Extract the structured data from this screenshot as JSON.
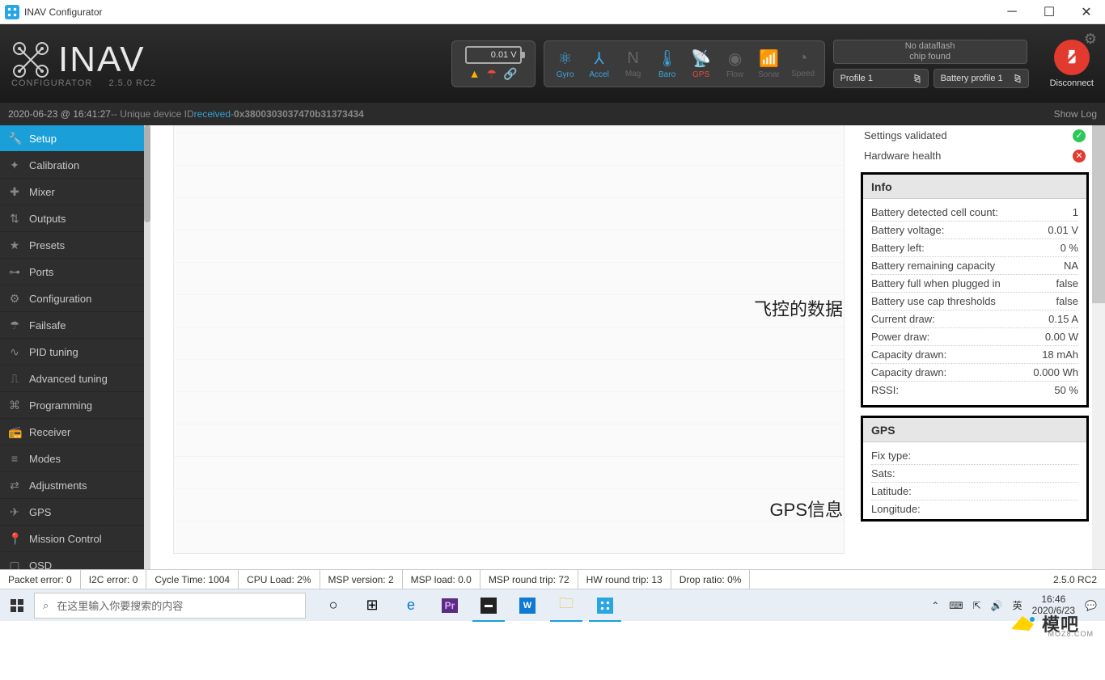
{
  "window": {
    "title": "INAV Configurator"
  },
  "logo": {
    "name": "INAV",
    "sub_left": "CONFIGURATOR",
    "sub_right": "2.5.0 RC2"
  },
  "battery": {
    "voltage": "0.01 V"
  },
  "sensors": [
    {
      "label": "Gyro",
      "cls": "s-blue",
      "glyph": "⚛"
    },
    {
      "label": "Accel",
      "cls": "s-blue",
      "glyph": "⅄"
    },
    {
      "label": "Mag",
      "cls": "s-grey",
      "glyph": "N"
    },
    {
      "label": "Baro",
      "cls": "s-blue",
      "glyph": "🌡"
    },
    {
      "label": "GPS",
      "cls": "s-red",
      "glyph": "📡"
    },
    {
      "label": "Flow",
      "cls": "s-grey",
      "glyph": "◉"
    },
    {
      "label": "Sonar",
      "cls": "s-grey",
      "glyph": "📶"
    },
    {
      "label": "Speed",
      "cls": "s-grey",
      "glyph": "◔"
    }
  ],
  "dataflash": {
    "line1": "No dataflash",
    "line2": "chip found"
  },
  "profiles": {
    "profile": "Profile 1",
    "battery": "Battery profile 1"
  },
  "disconnect": "Disconnect",
  "log": {
    "timestamp": "2020-06-23 @ 16:41:27",
    "mid": " -- Unique device ID ",
    "received": "received",
    "dash": " - ",
    "hex": "0x3800303037470b31373434",
    "showlog": "Show Log"
  },
  "sidebar": [
    {
      "label": "Setup",
      "icon": "🔧",
      "active": true
    },
    {
      "label": "Calibration",
      "icon": "✦"
    },
    {
      "label": "Mixer",
      "icon": "✚"
    },
    {
      "label": "Outputs",
      "icon": "⇅"
    },
    {
      "label": "Presets",
      "icon": "★"
    },
    {
      "label": "Ports",
      "icon": "⊶"
    },
    {
      "label": "Configuration",
      "icon": "⚙"
    },
    {
      "label": "Failsafe",
      "icon": "☂"
    },
    {
      "label": "PID tuning",
      "icon": "∿"
    },
    {
      "label": "Advanced tuning",
      "icon": "⎍"
    },
    {
      "label": "Programming",
      "icon": "⌘"
    },
    {
      "label": "Receiver",
      "icon": "📻"
    },
    {
      "label": "Modes",
      "icon": "≡"
    },
    {
      "label": "Adjustments",
      "icon": "⇄"
    },
    {
      "label": "GPS",
      "icon": "✈"
    },
    {
      "label": "Mission Control",
      "icon": "📍"
    },
    {
      "label": "OSD",
      "icon": "▢"
    }
  ],
  "annotations": {
    "fc_data": "飞控的数据",
    "gps_info": "GPS信息"
  },
  "status_checks": [
    {
      "label": "Settings validated",
      "ok": true
    },
    {
      "label": "Hardware health",
      "ok": false
    }
  ],
  "info_panel": {
    "title": "Info",
    "rows": [
      {
        "k": "Battery detected cell count:",
        "v": "1"
      },
      {
        "k": "Battery voltage:",
        "v": "0.01 V"
      },
      {
        "k": "Battery left:",
        "v": "0 %"
      },
      {
        "k": "Battery remaining capacity",
        "v": "NA"
      },
      {
        "k": "Battery full when plugged in",
        "v": "false"
      },
      {
        "k": "Battery use cap thresholds",
        "v": "false"
      },
      {
        "k": "Current draw:",
        "v": "0.15 A"
      },
      {
        "k": "Power draw:",
        "v": "0.00 W"
      },
      {
        "k": "Capacity drawn:",
        "v": "18 mAh"
      },
      {
        "k": "Capacity drawn:",
        "v": "0.000 Wh"
      },
      {
        "k": "RSSI:",
        "v": "50 %"
      }
    ]
  },
  "gps_panel": {
    "title": "GPS",
    "rows": [
      {
        "k": "Fix type:",
        "v": ""
      },
      {
        "k": "Sats:",
        "v": ""
      },
      {
        "k": "Latitude:",
        "v": ""
      },
      {
        "k": "Longitude:",
        "v": ""
      }
    ]
  },
  "statusbar": {
    "cells": [
      "Packet error: 0",
      "I2C error: 0",
      "Cycle Time: 1004",
      "CPU Load: 2%",
      "MSP version: 2",
      "MSP load: 0.0",
      "MSP round trip: 72",
      "HW round trip: 13",
      "Drop ratio: 0%"
    ],
    "version": "2.5.0 RC2"
  },
  "taskbar": {
    "search_placeholder": "在这里输入你要搜索的内容",
    "time": "16:46",
    "date": "2020/6/23",
    "ime": "英"
  },
  "watermark": {
    "text": "模吧",
    "sub": "MOZ8.COM"
  }
}
